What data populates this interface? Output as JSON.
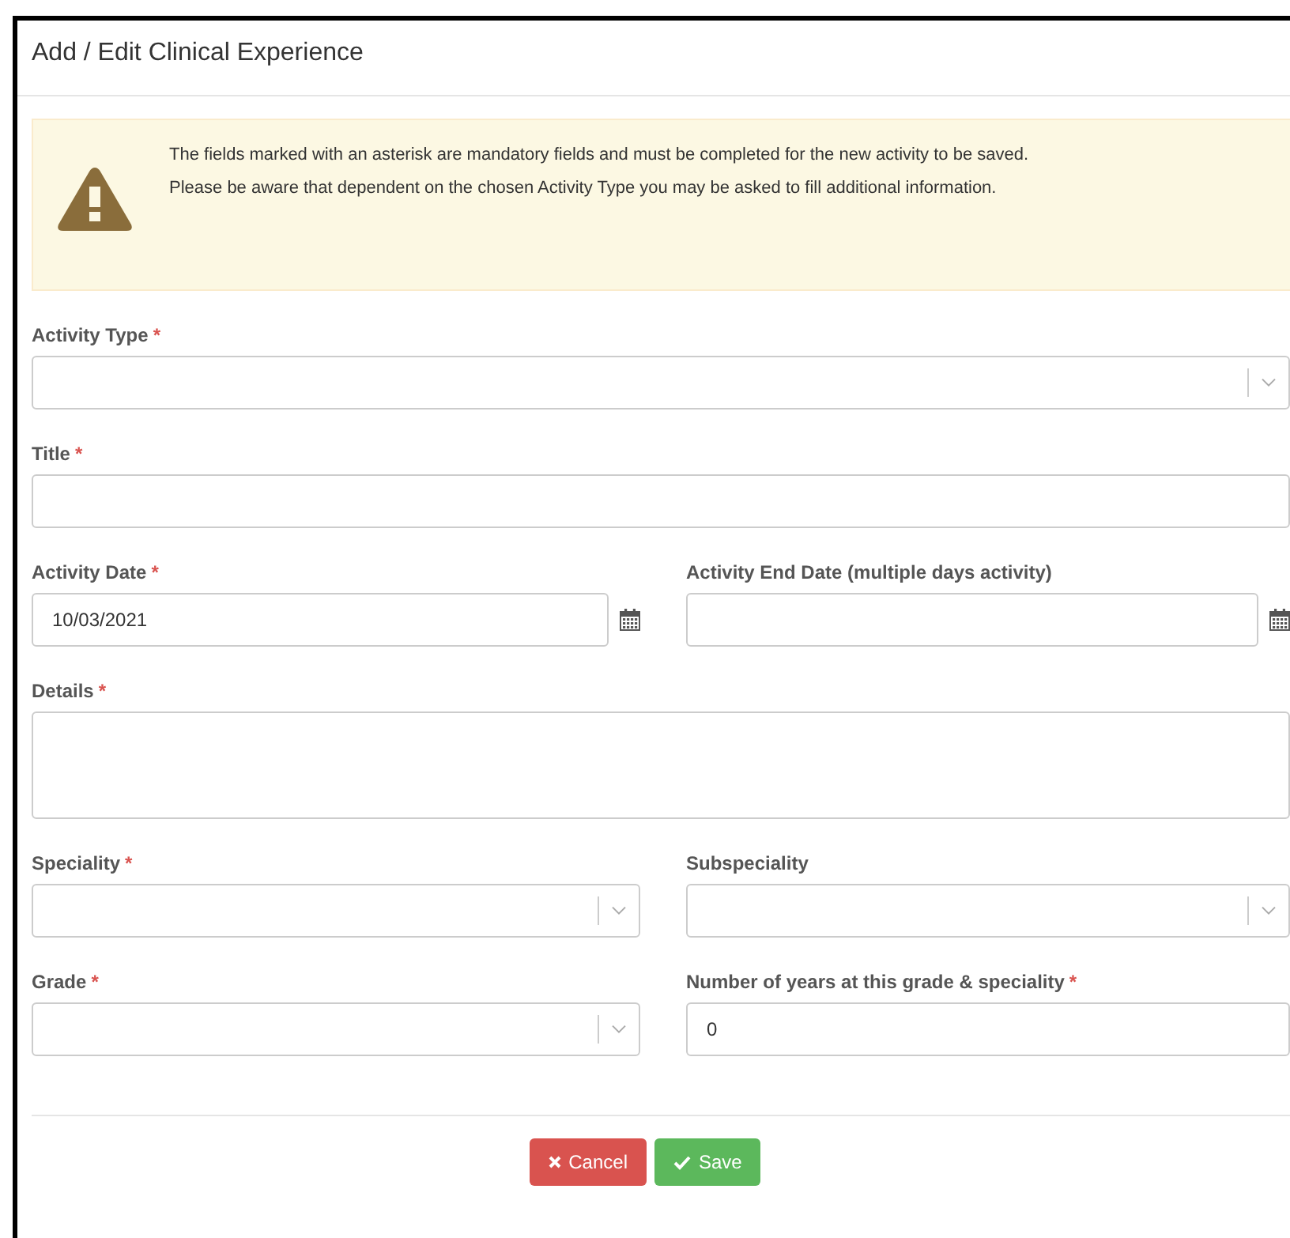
{
  "dialog": {
    "title": "Add / Edit Clinical Experience"
  },
  "alert": {
    "lines": [
      "The fields marked with an asterisk are mandatory fields and must be completed for the new activity to be saved.",
      "Please be aware that dependent on the chosen Activity Type you may be asked to fill additional information."
    ]
  },
  "rows": [
    {
      "fields": [
        {
          "kind": "select",
          "label": "Activity Type",
          "required_mark": "*"
        }
      ]
    },
    {
      "fields": [
        {
          "kind": "text",
          "label": "Title",
          "required_mark": "*"
        }
      ]
    },
    {
      "fields": [
        {
          "kind": "date",
          "label": "Activity Date",
          "required_mark": "*",
          "value": "10/03/2021"
        },
        {
          "kind": "date",
          "label": "Activity End Date (multiple days activity)"
        }
      ]
    },
    {
      "fields": [
        {
          "kind": "textarea",
          "label": "Details",
          "required_mark": "*"
        }
      ]
    },
    {
      "fields": [
        {
          "kind": "select",
          "label": "Speciality",
          "required_mark": "*"
        },
        {
          "kind": "select",
          "label": "Subspeciality"
        }
      ]
    },
    {
      "fields": [
        {
          "kind": "select",
          "label": "Grade",
          "required_mark": "*"
        },
        {
          "kind": "text",
          "label": "Number of years at this grade & speciality",
          "required_mark": "*",
          "value": "0"
        }
      ]
    }
  ],
  "buttons": [
    {
      "kind": "cancel",
      "label": "Cancel"
    },
    {
      "kind": "save",
      "label": "Save"
    }
  ]
}
